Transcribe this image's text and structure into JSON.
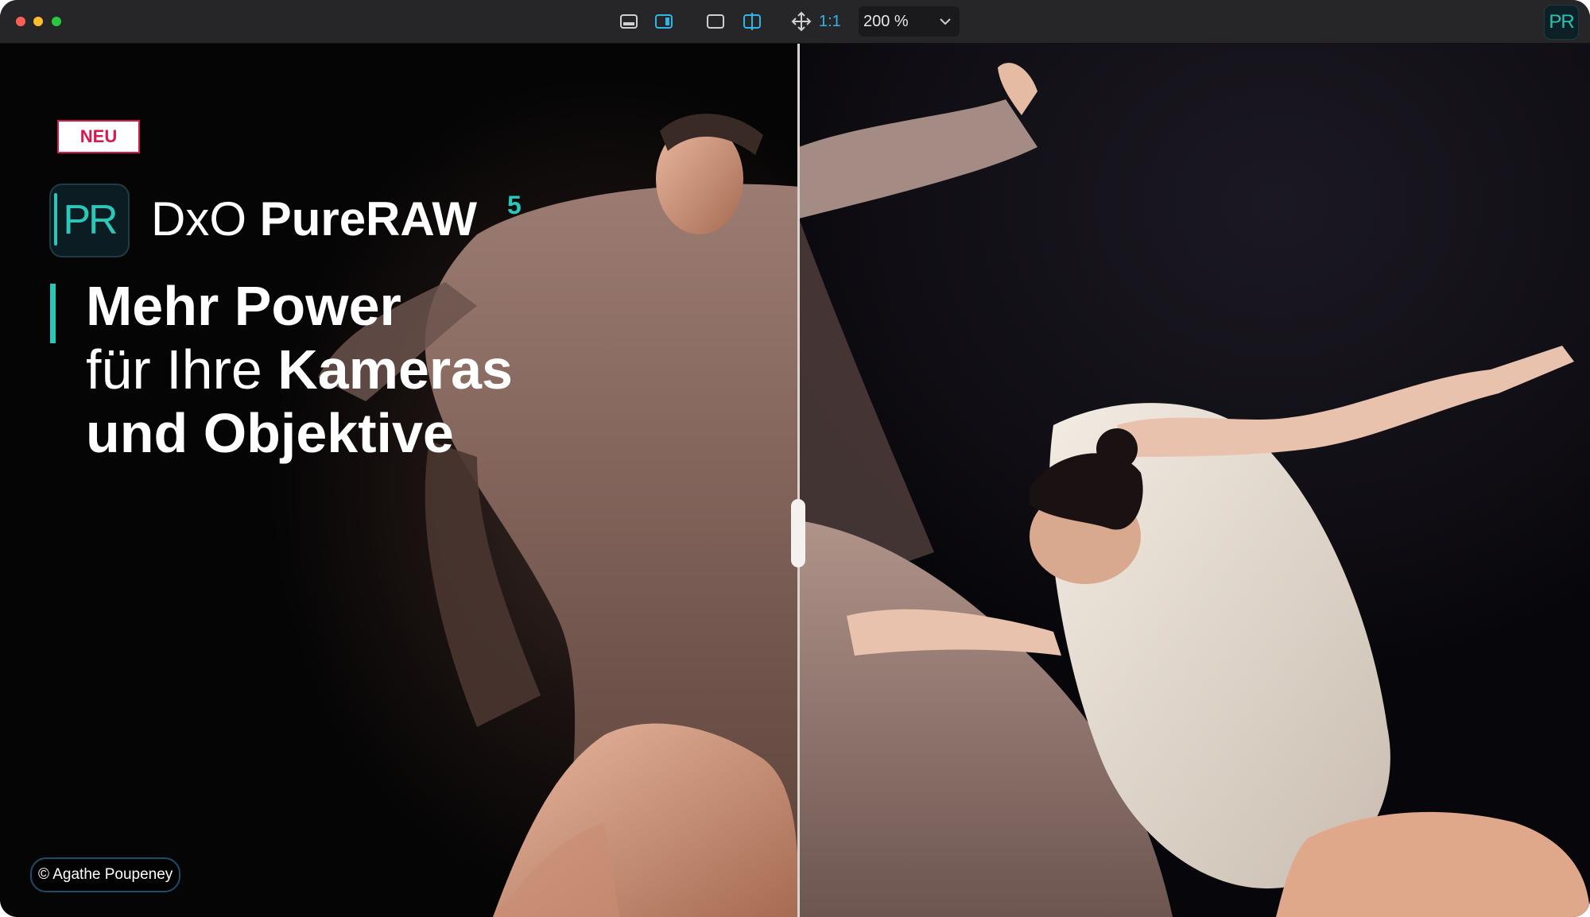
{
  "toolbar": {
    "icons": [
      "panel-bottom-icon",
      "panel-right-icon",
      "single-view-icon",
      "split-view-icon",
      "move-icon"
    ],
    "ratio_label": "1:1",
    "zoom_value": "200 %",
    "accent_color": "#2fb5e8"
  },
  "app_logo": {
    "text": "PR",
    "color": "#2bc7b8"
  },
  "promo": {
    "badge": "NEU",
    "badge_color": "#d8194f",
    "brand_prefix": "DxO",
    "brand_product": "PureRAW",
    "brand_version": "5",
    "headline_line1": "Mehr Power",
    "headline_line2_light": "für Ihre ",
    "headline_line2_bold": "Kameras",
    "headline_line3": "und Objektive",
    "accent_color": "#2bc7b8"
  },
  "photo": {
    "credit": "© Agathe Poupeney",
    "comparison": "split-before-after"
  }
}
